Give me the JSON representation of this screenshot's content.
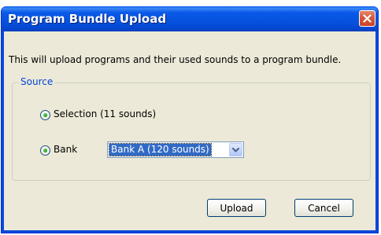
{
  "window": {
    "title": "Program Bundle Upload"
  },
  "dialog": {
    "description": "This will upload programs and their used sounds to a program bundle."
  },
  "source_group": {
    "legend": "Source",
    "options": [
      {
        "label": "Selection (11 sounds)",
        "selected": true
      },
      {
        "label": "Bank",
        "selected": true
      }
    ],
    "bank_select": {
      "value": "Bank A (120 sounds)"
    }
  },
  "buttons": {
    "upload_label": "Upload",
    "cancel_label": "Cancel"
  },
  "icons": {
    "close": "close-icon",
    "dropdown": "chevron-down-icon",
    "radio_dot": "radio-selected-icon"
  },
  "colors": {
    "titlebar": "#0a59e8",
    "dialog_background": "#ece9d8",
    "group_legend": "#0046d5",
    "selection": "#316ac5",
    "close_button": "#d75a37"
  }
}
